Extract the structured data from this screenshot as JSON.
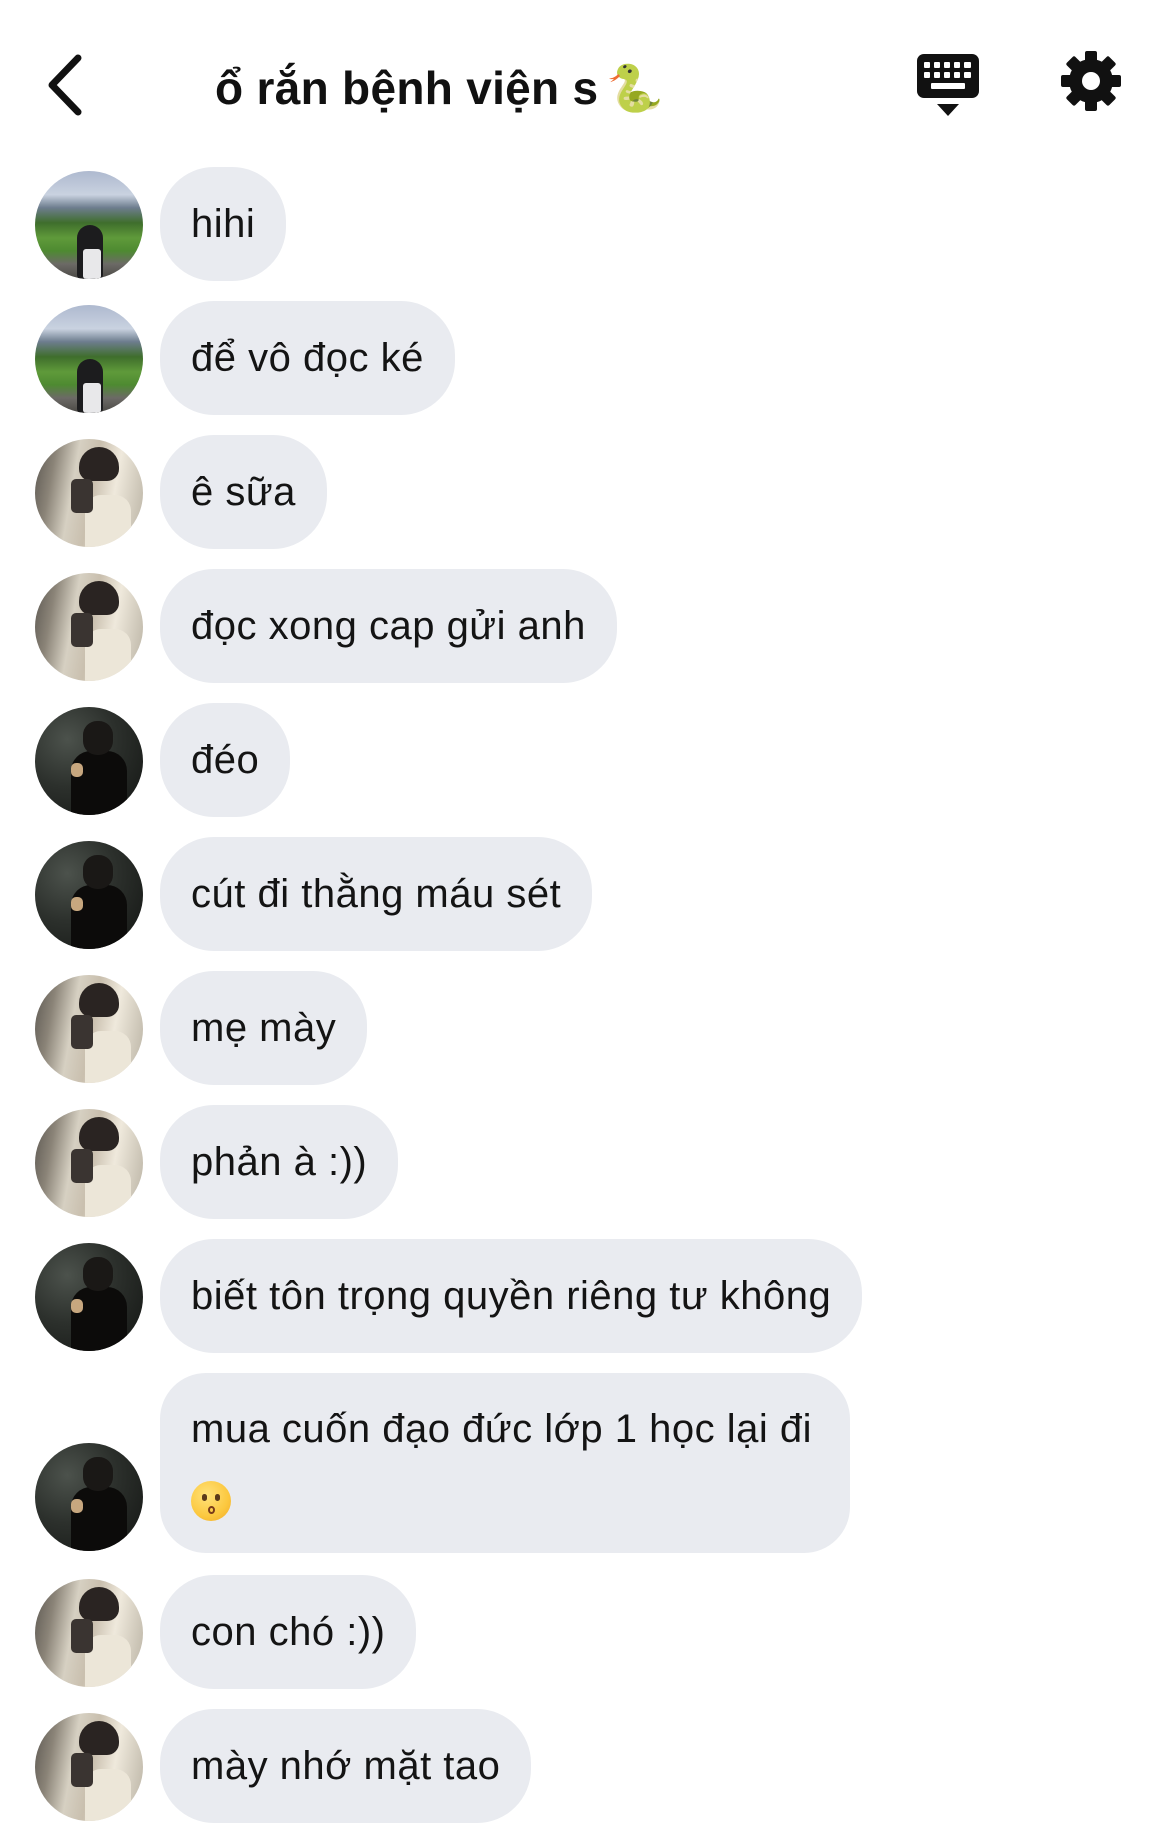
{
  "header": {
    "back_icon": "chevron-left-icon",
    "title": "ổ rắn bệnh viện s",
    "title_emoji": "🐍",
    "keyboard_icon": "keyboard-icon",
    "settings_icon": "gear-icon"
  },
  "messages": [
    {
      "avatar": "stadium",
      "text": "hihi"
    },
    {
      "avatar": "stadium",
      "text": "để vô đọc ké"
    },
    {
      "avatar": "mirror",
      "text": "ê sữa"
    },
    {
      "avatar": "mirror",
      "text": "đọc xong cap gửi anh"
    },
    {
      "avatar": "dark",
      "text": "đéo"
    },
    {
      "avatar": "dark",
      "text": "cút đi thằng máu sét"
    },
    {
      "avatar": "mirror",
      "text": "mẹ mày"
    },
    {
      "avatar": "mirror",
      "text": "phản à :))"
    },
    {
      "avatar": "dark",
      "text": "biết tôn trọng quyền riêng tư không"
    },
    {
      "avatar": "dark",
      "text": "mua cuốn đạo đức lớp 1 học lại đi",
      "emoji": "kissing-face-emoji"
    },
    {
      "avatar": "mirror",
      "text": "con chó :))"
    },
    {
      "avatar": "mirror",
      "text": "mày nhớ mặt tao"
    }
  ],
  "colors": {
    "bubble_bg": "#e9ebf0",
    "text": "#141414",
    "background": "#ffffff"
  }
}
